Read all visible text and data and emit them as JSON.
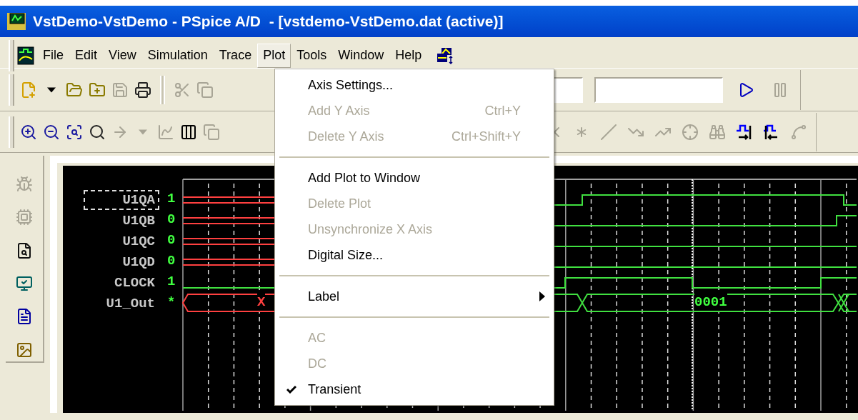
{
  "window": {
    "title": "VstDemo-VstDemo - PSpice A/D  - [vstdemo-VstDemo.dat (active)]"
  },
  "menu_bar": [
    {
      "label": "File",
      "selected": false
    },
    {
      "label": "Edit",
      "selected": false
    },
    {
      "label": "View",
      "selected": false
    },
    {
      "label": "Simulation",
      "selected": false
    },
    {
      "label": "Trace",
      "selected": false
    },
    {
      "label": "Plot",
      "selected": true
    },
    {
      "label": "Tools",
      "selected": false
    },
    {
      "label": "Window",
      "selected": false
    },
    {
      "label": "Help",
      "selected": false
    }
  ],
  "toolbar_1_left": [
    {
      "kind": "new",
      "disabled": false
    },
    {
      "kind": "dropdown",
      "disabled": false
    },
    {
      "kind": "open",
      "disabled": false
    },
    {
      "kind": "append",
      "disabled": false
    },
    {
      "kind": "save",
      "disabled": true
    },
    {
      "kind": "print",
      "disabled": false
    },
    {
      "kind": "grip"
    },
    {
      "kind": "cut",
      "disabled": true
    },
    {
      "kind": "copy",
      "disabled": true
    }
  ],
  "toolbar_1_right": [
    {
      "kind": "run",
      "disabled": false
    },
    {
      "kind": "pause",
      "disabled": true
    }
  ],
  "toolbar_2_left": [
    {
      "kind": "zoom-in",
      "disabled": false
    },
    {
      "kind": "zoom-out",
      "disabled": false
    },
    {
      "kind": "zoom-area",
      "disabled": false
    },
    {
      "kind": "zoom-fit",
      "disabled": false
    },
    {
      "kind": "arrow",
      "disabled": true
    },
    {
      "kind": "dropdown",
      "disabled": true
    },
    {
      "kind": "graph",
      "disabled": true
    },
    {
      "kind": "bars",
      "disabled": false
    },
    {
      "kind": "copy",
      "disabled": true
    }
  ],
  "toolbar_2_right": [
    {
      "kind": "cross",
      "disabled": true
    },
    {
      "kind": "star",
      "disabled": true
    },
    {
      "kind": "slope",
      "disabled": true
    },
    {
      "kind": "valley",
      "disabled": true
    },
    {
      "kind": "peak",
      "disabled": true
    },
    {
      "kind": "point",
      "disabled": true
    },
    {
      "kind": "search",
      "disabled": true
    },
    {
      "kind": "next-edge",
      "disabled": false
    },
    {
      "kind": "prev-edge",
      "disabled": false
    },
    {
      "kind": "label-point",
      "disabled": true
    }
  ],
  "side_toolbar": [
    {
      "kind": "bug",
      "disabled": true
    },
    {
      "kind": "board",
      "disabled": true
    },
    {
      "kind": "file-search",
      "disabled": false
    },
    {
      "kind": "monitor",
      "disabled": false
    },
    {
      "kind": "list",
      "disabled": false
    },
    {
      "kind": "image",
      "disabled": false
    }
  ],
  "plot_menu": [
    {
      "kind": "item",
      "label": "Axis Settings...",
      "disabled": false,
      "checked": false
    },
    {
      "kind": "item",
      "label": "Add Y Axis",
      "shortcut": "Ctrl+Y",
      "disabled": true,
      "checked": false
    },
    {
      "kind": "item",
      "label": "Delete Y Axis",
      "shortcut": "Ctrl+Shift+Y",
      "disabled": true,
      "checked": false
    },
    {
      "kind": "separator"
    },
    {
      "kind": "item",
      "label": "Add Plot to Window",
      "disabled": false,
      "checked": false
    },
    {
      "kind": "item",
      "label": "Delete Plot",
      "disabled": true,
      "checked": false
    },
    {
      "kind": "item",
      "label": "Unsynchronize X Axis",
      "disabled": true,
      "checked": false
    },
    {
      "kind": "item",
      "label": "Digital Size...",
      "disabled": false,
      "checked": false
    },
    {
      "kind": "separator"
    },
    {
      "kind": "submenu",
      "label": "Label",
      "disabled": false,
      "checked": false
    },
    {
      "kind": "separator"
    },
    {
      "kind": "item",
      "label": "AC",
      "disabled": true,
      "checked": false
    },
    {
      "kind": "item",
      "label": "DC",
      "disabled": true,
      "checked": false
    },
    {
      "kind": "item",
      "label": "Transient",
      "disabled": false,
      "checked": true
    }
  ],
  "traces": [
    {
      "name": "U1QA",
      "value": "1",
      "selected": true
    },
    {
      "name": "U1QB",
      "value": "0",
      "selected": false
    },
    {
      "name": "U1QC",
      "value": "0",
      "selected": false
    },
    {
      "name": "U1QD",
      "value": "0",
      "selected": false
    },
    {
      "name": "CLOCK",
      "value": "1",
      "selected": false
    },
    {
      "name": "U1_Out",
      "value": "*",
      "selected": false,
      "bus_values": [
        "X",
        "0001"
      ]
    }
  ]
}
